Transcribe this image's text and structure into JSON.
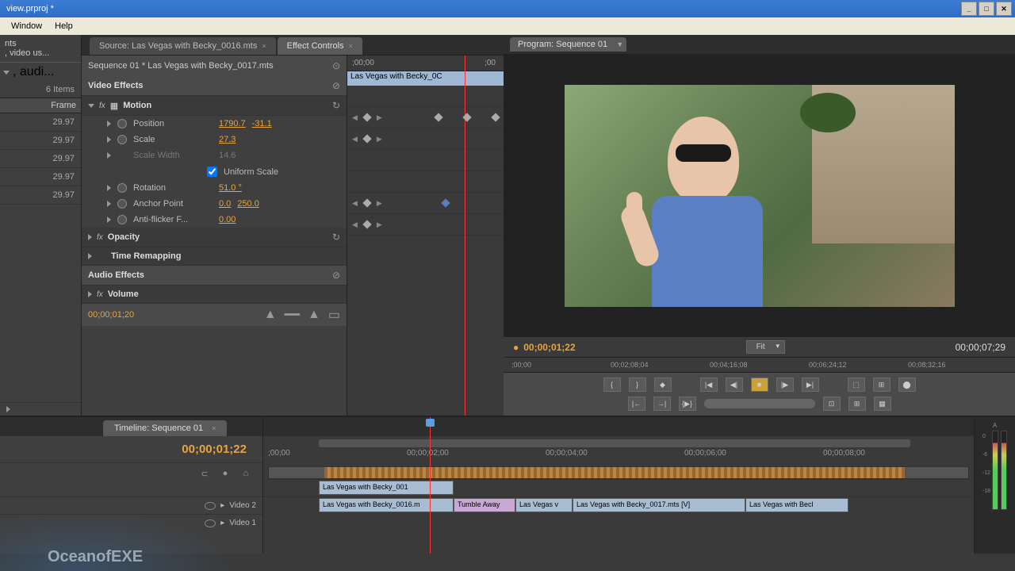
{
  "window": {
    "title": "view.prproj *"
  },
  "menu": {
    "window": "Window",
    "help": "Help"
  },
  "project": {
    "label1": "nts",
    "label2": ", video us...",
    "label3": ", audi...",
    "items_count": "6 Items",
    "frame_header": "Frame",
    "rates": [
      "29.97",
      "29.97",
      "29.97",
      "29.97",
      "29.97"
    ]
  },
  "tabs": {
    "source": "Source: Las Vegas with Becky_0016.mts",
    "effect": "Effect Controls"
  },
  "effect": {
    "seq_header": "Sequence 01 * Las Vegas with Becky_0017.mts",
    "video_effects": "Video Effects",
    "motion": "Motion",
    "position": "Position",
    "pos_x": "1790.7",
    "pos_y": "-31.1",
    "scale": "Scale",
    "scale_v": "27.3",
    "scale_width": "Scale Width",
    "scale_w_v": "14.6",
    "uniform": "Uniform Scale",
    "rotation": "Rotation",
    "rotation_v": "51.0 °",
    "anchor": "Anchor Point",
    "anchor_x": "0.0",
    "anchor_y": "250.0",
    "antiflicker": "Anti-flicker F...",
    "antiflicker_v": "0.00",
    "opacity": "Opacity",
    "time_remap": "Time Remapping",
    "audio_effects": "Audio Effects",
    "volume": "Volume",
    "ec_tc": "00;00;01;20",
    "ruler_t1": ";00;00",
    "ruler_t2": ";00",
    "clip_label": "Las Vegas with Becky_0C"
  },
  "program": {
    "tab": "Program: Sequence 01",
    "tc_current": "00;00;01;22",
    "fit": "Fit",
    "tc_total": "00;00;07;29",
    "ruler": [
      ";00;00",
      "00;02;08;04",
      "00;04;16;08",
      "00;06;24;12",
      "00;08;32;16"
    ]
  },
  "timeline": {
    "tab": "Timeline: Sequence 01",
    "tc": "00;00;01;22",
    "ruler": [
      ";00;00",
      "00;00;02;00",
      "00;00;04;00",
      "00;00;06;00",
      "00;00;08;00"
    ],
    "v2": "Video 2",
    "v1": "Video 1",
    "clips": {
      "v2_c1": "Las Vegas with Becky_001",
      "v1_c1": "Las Vegas with Becky_0016.m",
      "v1_c2": "Tumble Away",
      "v1_c3": "Las Vegas v",
      "v1_c4": "Las Vegas with Becky_0017.mts [V]",
      "v1_c5": "Las Vegas with Becl"
    }
  },
  "meters": {
    "a_label": "A",
    "s0": "0",
    "s6": "-6",
    "s12": "-12",
    "s18": "-18"
  },
  "watermark": "OceanofEXE"
}
